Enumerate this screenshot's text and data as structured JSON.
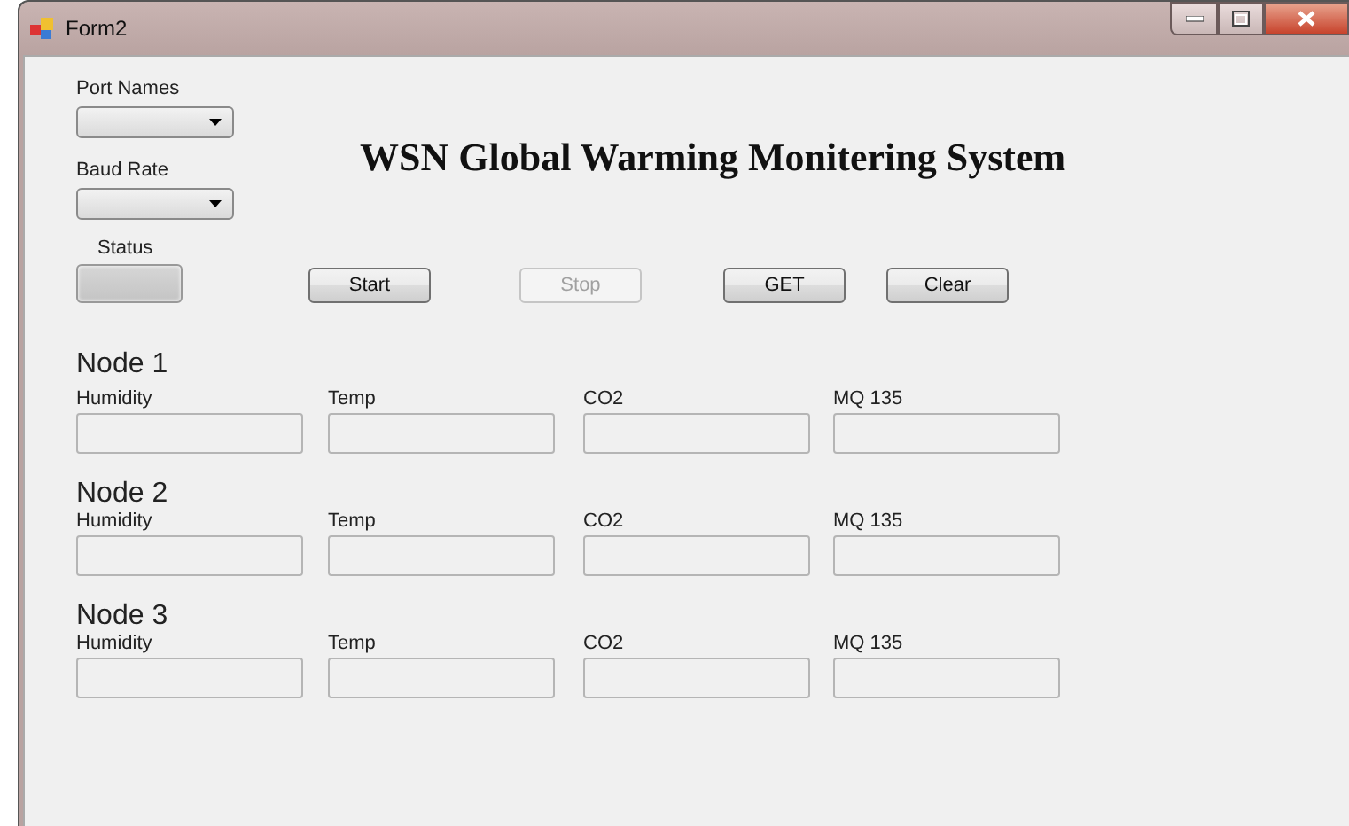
{
  "window": {
    "title": "Form2"
  },
  "port_names": {
    "label": "Port Names"
  },
  "baud_rate": {
    "label": "Baud Rate"
  },
  "heading": "WSN Global Warming Monitering System",
  "status": {
    "label": "Status"
  },
  "buttons": [
    {
      "label": "Start",
      "disabled": false
    },
    {
      "label": "Stop",
      "disabled": true
    },
    {
      "label": "GET",
      "disabled": false
    },
    {
      "label": "Clear",
      "disabled": false
    }
  ],
  "nodes": [
    {
      "title": "Node 1",
      "fields": [
        "Humidity",
        "Temp",
        "CO2",
        "MQ 135"
      ]
    },
    {
      "title": "Node 2",
      "fields": [
        "Humidity",
        "Temp",
        "CO2",
        "MQ 135"
      ]
    },
    {
      "title": "Node 3",
      "fields": [
        "Humidity",
        "Temp",
        "CO2",
        "MQ 135"
      ]
    }
  ]
}
